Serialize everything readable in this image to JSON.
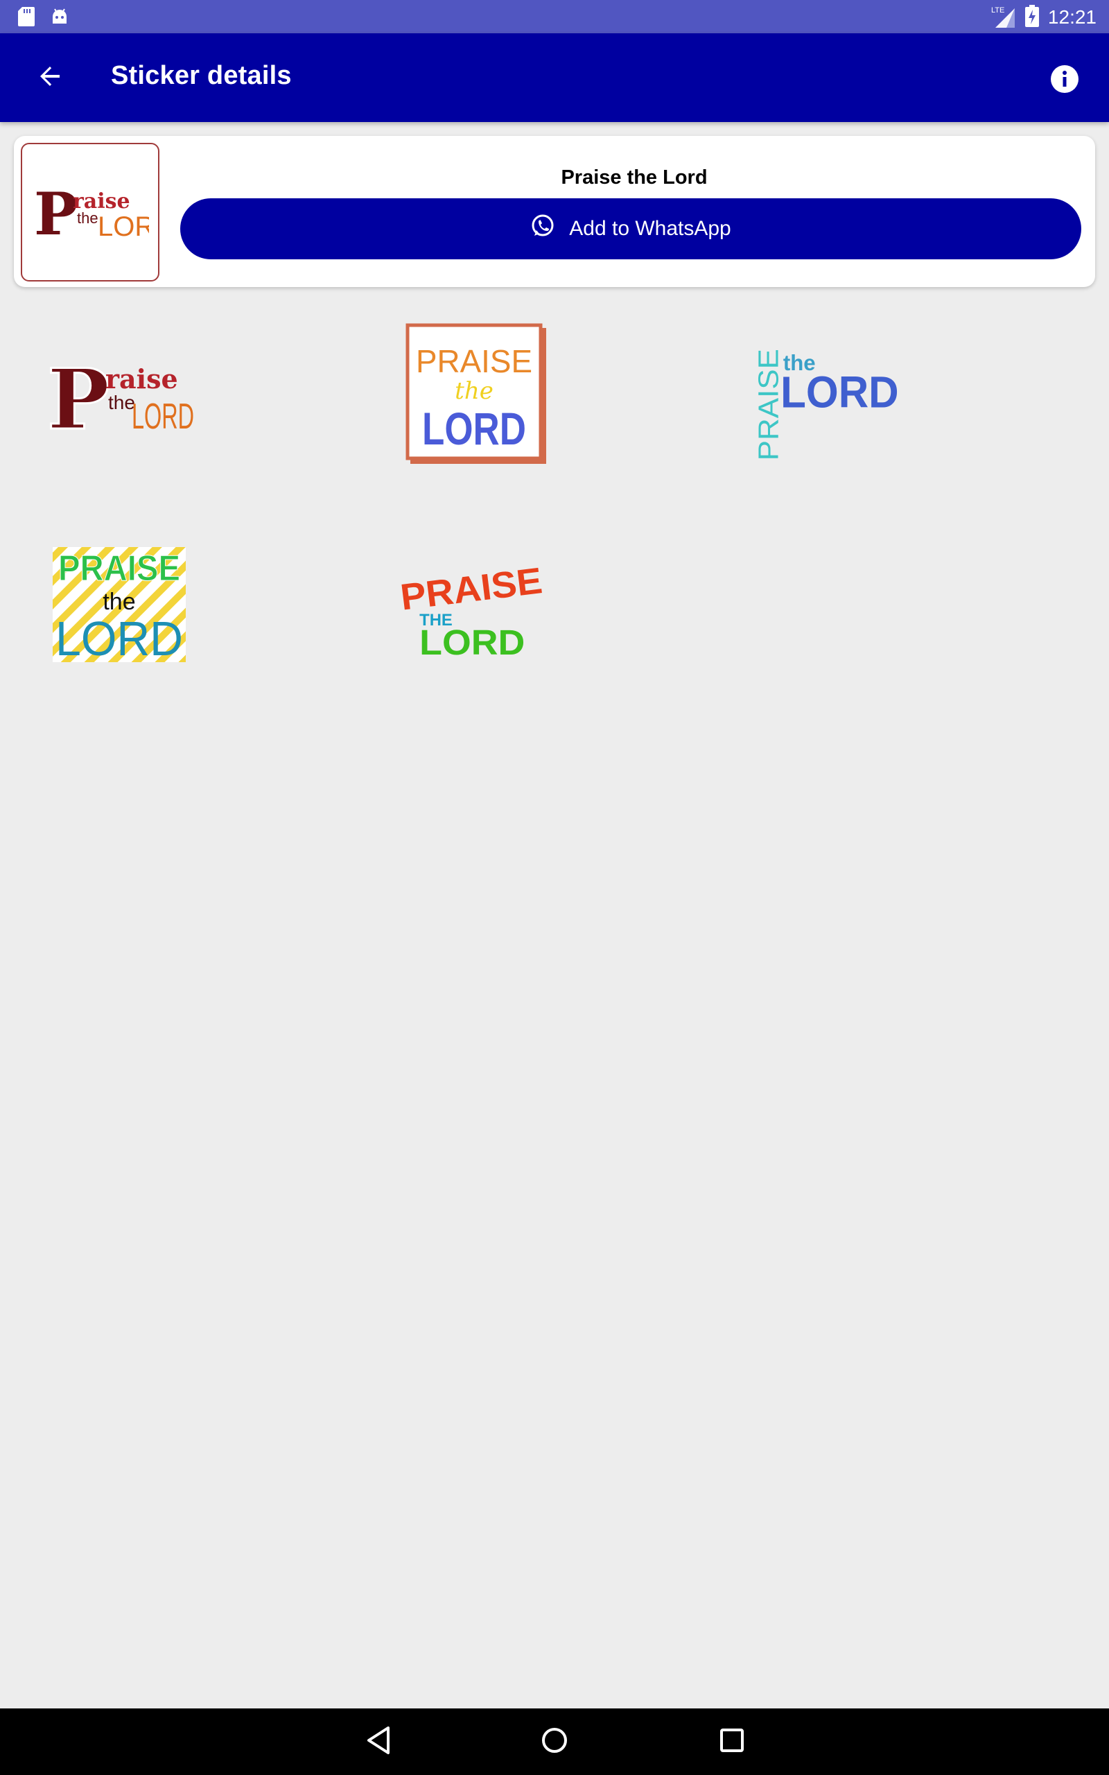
{
  "status_bar": {
    "time": "12:21",
    "network": "LTE",
    "icons": [
      "sd-card-icon",
      "android-icon",
      "signal-icon",
      "battery-charging-icon"
    ]
  },
  "app_bar": {
    "title": "Sticker details",
    "back_icon": "arrow-back-icon",
    "info_icon": "info-icon"
  },
  "pack": {
    "name": "Praise the Lord",
    "add_button_label": "Add to WhatsApp",
    "add_button_icon": "whatsapp-icon"
  },
  "stickers": [
    {
      "lines": [
        "P",
        "raise",
        "the",
        "LORD"
      ]
    },
    {
      "lines": [
        "PRAISE",
        "the",
        "LORD"
      ]
    },
    {
      "lines": [
        "PRAISE",
        "the",
        "LORD"
      ]
    },
    {
      "lines": [
        "PRAISE",
        "the",
        "LORD"
      ]
    },
    {
      "lines": [
        "PRAISE",
        "THE",
        "LORD"
      ]
    }
  ],
  "nav_bar": {
    "icons": [
      "nav-back-icon",
      "nav-home-icon",
      "nav-recents-icon"
    ]
  },
  "colors": {
    "status_bar": "#5156c1",
    "primary": "#0000a0",
    "background": "#ededed"
  }
}
